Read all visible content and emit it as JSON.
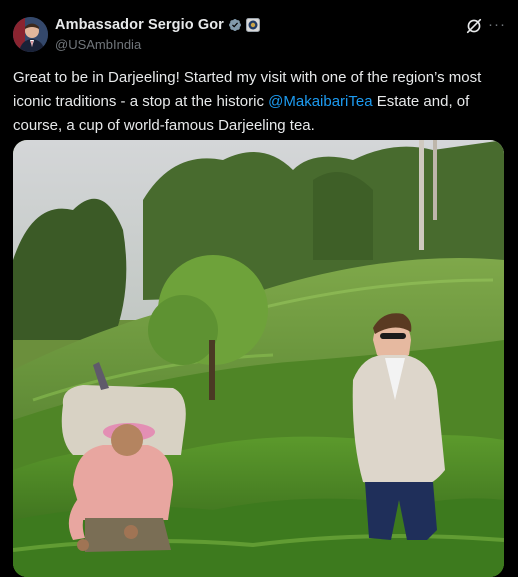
{
  "post": {
    "author_name": "Ambassador Sergio Gor",
    "author_handle": "@USAmbIndia",
    "verified": true,
    "text_before_mention": "Great to be in Darjeeling! Started my visit with one of the region’s most iconic traditions - a stop at the historic ",
    "mention": "@MakaibariTea",
    "text_after_mention": " Estate and, of course, a cup of world-famous Darjeeling tea.",
    "more_label": "···"
  },
  "icons": {
    "verified": "verified-badge-icon",
    "affiliation": "government-seal-icon",
    "grok": "grok-icon",
    "more": "more-options-icon"
  },
  "colors": {
    "background": "#000000",
    "text": "#e7e9ea",
    "secondary_text": "#71767b",
    "link": "#1d9bf0",
    "verified": "#829aab"
  }
}
